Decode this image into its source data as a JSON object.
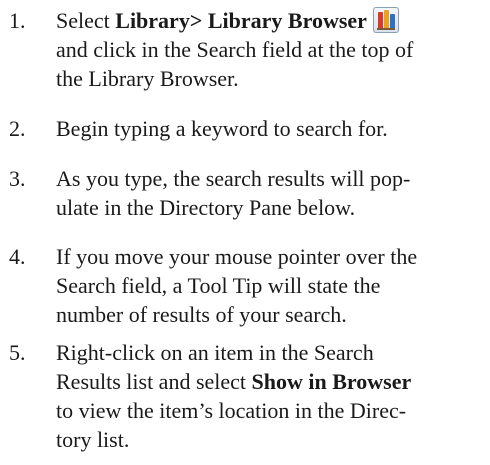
{
  "steps": [
    {
      "number": "1.",
      "line1_pre": "Select ",
      "line1_bold": "Library> Library Browser",
      "icon": "library-books-icon",
      "line2": "and click in the Search field at the top of",
      "line3": "the Library Browser."
    },
    {
      "number": "2.",
      "line1": "Begin typing a keyword to search for."
    },
    {
      "number": "3.",
      "line1": "As you type, the search results will pop-",
      "line2": "ulate in the Directory Pane below."
    },
    {
      "number": "4.",
      "line1": "If you move your mouse pointer over the",
      "line2": "Search field, a Tool Tip will state the",
      "line3": "number of results of your search."
    },
    {
      "number": "5.",
      "line1": "Right-click on an item in the Search",
      "line2_pre": "Results list and select ",
      "line2_bold": "Show in Browser",
      "line3": "to view the item’s location in the Direc-",
      "line4": "tory list."
    }
  ]
}
